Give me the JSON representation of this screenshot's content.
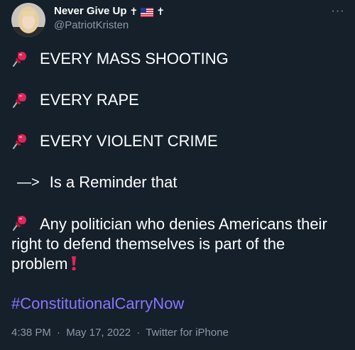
{
  "user": {
    "display_name": "Never Give Up",
    "handle": "@PatriotKristen"
  },
  "tweet": {
    "lines": [
      "EVERY MASS SHOOTING",
      "EVERY RAPE",
      "EVERY VIOLENT CRIME"
    ],
    "arrow": "—>",
    "reminder": "Is a Reminder that",
    "paragraph": "Any politician who denies Americans their right to defend themselves is part of the problem",
    "hashtag": "#ConstitutionalCarryNow"
  },
  "meta": {
    "time": "4:38 PM",
    "date": "May 17, 2022",
    "source": "Twitter for iPhone",
    "separator": "·"
  },
  "icons": {
    "pin": "pushpin-icon",
    "exclamation": "red-exclamation-icon",
    "flag": "us-flag-icon",
    "cross": "latin-cross-icon",
    "more": "more-options-icon"
  },
  "colors": {
    "background": "#15202b",
    "text": "#ffffff",
    "secondary": "#8b98a5",
    "hashtag": "#8b74ff",
    "accent_red": "#e0245e"
  }
}
